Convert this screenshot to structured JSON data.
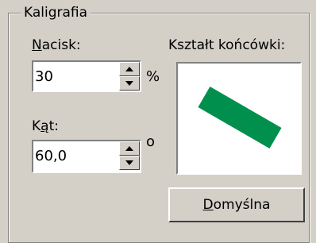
{
  "group": {
    "title": "Kaligrafia"
  },
  "pressure": {
    "label_accel": "N",
    "label_rest": "acisk:",
    "value": "30",
    "unit": "%"
  },
  "angle": {
    "label_pre": "K",
    "label_accel": "ą",
    "label_rest": "t:",
    "value": "60,0",
    "unit": "o"
  },
  "tip_shape": {
    "label": "Kształt końcówki:",
    "color": "#008f4c",
    "angle_deg": 30
  },
  "default_button": {
    "label_accel": "D",
    "label_rest": "omyślna"
  }
}
